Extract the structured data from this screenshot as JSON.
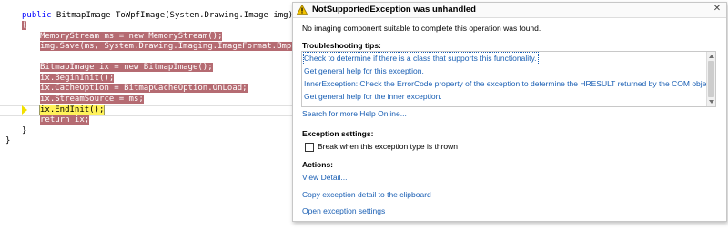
{
  "editor": {
    "lines": [
      {
        "tokens": [
          {
            "t": "public",
            "c": "kw"
          },
          {
            "t": " BitmapImage ToWpfImage(System.Drawing.Image img)",
            "c": ""
          }
        ]
      },
      {
        "tokens": [
          {
            "t": "{",
            "c": "brace-hl"
          }
        ]
      },
      {
        "tokens": [
          {
            "t": "MemoryStream ms = new MemoryStream();",
            "c": "hl"
          }
        ]
      },
      {
        "tokens": [
          {
            "t": "img.Save(ms, System.Drawing.Imaging.ImageFormat.Bmp);",
            "c": "hl"
          }
        ]
      },
      {
        "tokens": [
          {
            "t": "",
            "c": ""
          }
        ]
      },
      {
        "tokens": [
          {
            "t": "BitmapImage ix = new BitmapImage();",
            "c": "hl"
          }
        ]
      },
      {
        "tokens": [
          {
            "t": "ix.BeginInit();",
            "c": "hl"
          }
        ]
      },
      {
        "tokens": [
          {
            "t": "ix.CacheOption = BitmapCacheOption.OnLoad;",
            "c": "hl"
          }
        ]
      },
      {
        "tokens": [
          {
            "t": "ix.StreamSource = ms;",
            "c": "hl"
          }
        ]
      },
      {
        "tokens": [
          {
            "t": "ix.EndInit();",
            "c": "hl-cur"
          }
        ]
      },
      {
        "tokens": [
          {
            "t": "return ix;",
            "c": "hl"
          }
        ]
      },
      {
        "tokens": [
          {
            "t": "}",
            "c": ""
          }
        ]
      },
      {
        "tokens": [
          {
            "t": "}",
            "c": ""
          }
        ]
      }
    ]
  },
  "helper": {
    "title": "NotSupportedException was unhandled",
    "message": "No imaging component suitable to complete this operation was found.",
    "tips_title": "Troubleshooting tips:",
    "tips": [
      "Check to determine if there is a class that supports this functionality.",
      "Get general help for this exception.",
      "InnerException: Check the ErrorCode property of the exception to determine the HRESULT returned by the COM object.",
      "Get general help for the inner exception."
    ],
    "search_link": "Search for more Help Online...",
    "settings_title": "Exception settings:",
    "checkbox_label": "Break when this exception type is thrown",
    "actions_title": "Actions:",
    "actions": [
      "View Detail...",
      "Copy exception detail to the clipboard",
      "Open exception settings"
    ],
    "close_glyph": "✕"
  },
  "colors": {
    "keyword": "#0000ff",
    "statement_highlight": "#b56b72",
    "current_statement": "#fff25a",
    "link": "#1a5fb4",
    "warning": "#f2c200"
  }
}
